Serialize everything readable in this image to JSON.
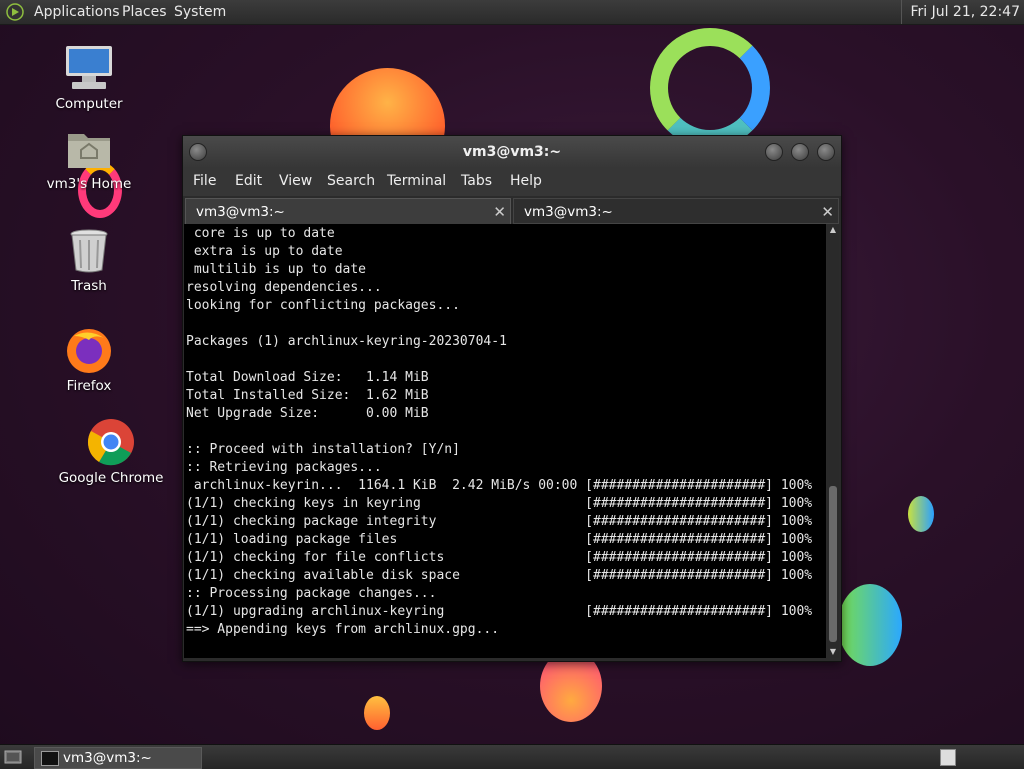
{
  "top_panel": {
    "menus": [
      "Applications",
      "Places",
      "System"
    ],
    "clock": "Fri Jul 21, 22:47"
  },
  "desktop": {
    "icons": [
      {
        "label": "Computer",
        "icon": "computer-icon"
      },
      {
        "label": "vm3's Home",
        "icon": "home-folder-icon"
      },
      {
        "label": "Trash",
        "icon": "trash-icon"
      },
      {
        "label": "Firefox",
        "icon": "firefox-icon"
      },
      {
        "label": "Google Chrome",
        "icon": "chrome-icon"
      }
    ]
  },
  "window": {
    "title": "vm3@vm3:~",
    "menu": [
      "File",
      "Edit",
      "View",
      "Search",
      "Terminal",
      "Tabs",
      "Help"
    ],
    "tabs": [
      {
        "label": "vm3@vm3:~",
        "active": true
      },
      {
        "label": "vm3@vm3:~",
        "active": false
      }
    ],
    "terminal_lines": [
      " core is up to date",
      " extra is up to date",
      " multilib is up to date",
      "resolving dependencies...",
      "looking for conflicting packages...",
      "",
      "Packages (1) archlinux-keyring-20230704-1",
      "",
      "Total Download Size:   1.14 MiB",
      "Total Installed Size:  1.62 MiB",
      "Net Upgrade Size:      0.00 MiB",
      "",
      ":: Proceed with installation? [Y/n]",
      ":: Retrieving packages...",
      " archlinux-keyrin...  1164.1 KiB  2.42 MiB/s 00:00 [######################] 100%",
      "(1/1) checking keys in keyring                     [######################] 100%",
      "(1/1) checking package integrity                   [######################] 100%",
      "(1/1) loading package files                        [######################] 100%",
      "(1/1) checking for file conflicts                  [######################] 100%",
      "(1/1) checking available disk space                [######################] 100%",
      ":: Processing package changes...",
      "(1/1) upgrading archlinux-keyring                  [######################] 100%",
      "==> Appending keys from archlinux.gpg..."
    ]
  },
  "taskbar": {
    "task_label": "vm3@vm3:~"
  },
  "colors": {
    "background": "#2a1028",
    "terminal_bg": "#000000",
    "terminal_fg": "#e6e6e6"
  }
}
